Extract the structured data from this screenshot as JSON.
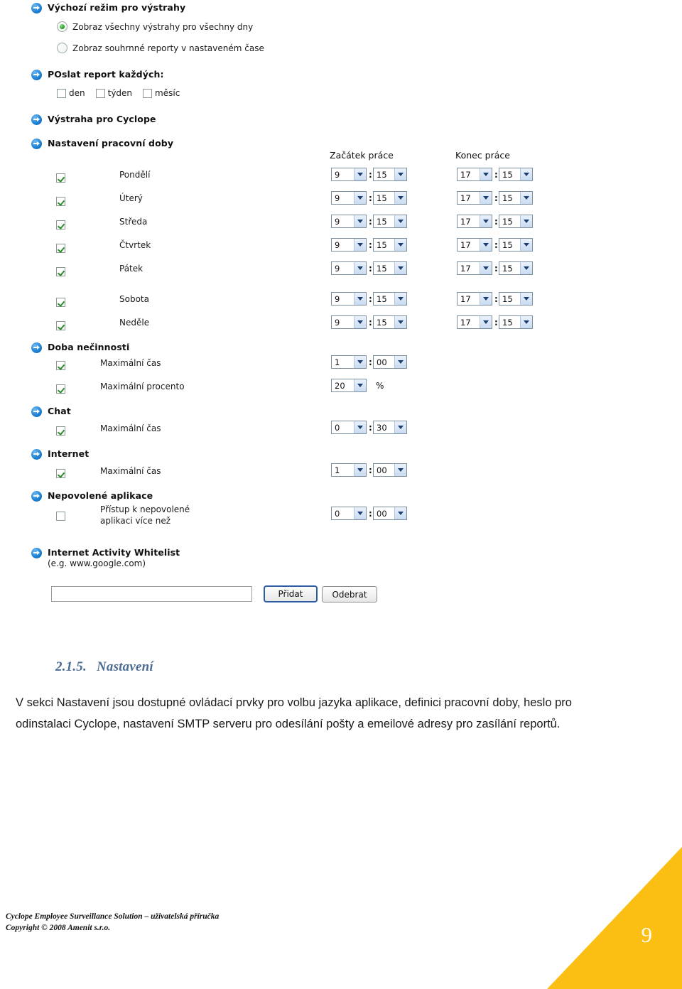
{
  "app": {
    "sections": {
      "alert_mode": {
        "title": "Výchozí režim pro výstrahy",
        "options": [
          {
            "label": "Zobraz všechny výstrahy pro všechny dny",
            "selected": true
          },
          {
            "label": "Zobraz souhrnné reporty v nastaveném čase",
            "selected": false
          }
        ]
      },
      "report_interval": {
        "title": "POslat report každých:",
        "checkboxes": [
          {
            "label": "den",
            "checked": false
          },
          {
            "label": "týden",
            "checked": false
          },
          {
            "label": "měsíc",
            "checked": false
          }
        ]
      },
      "cyclope_alert": {
        "title": "Výstraha pro Cyclope"
      },
      "work_hours": {
        "title": "Nastavení pracovní doby",
        "col_start": "Začátek práce",
        "col_end": "Konec práce",
        "days": [
          {
            "label": "Pondělí",
            "checked": true,
            "start_h": "9",
            "start_m": "15",
            "end_h": "17",
            "end_m": "15"
          },
          {
            "label": "Úterý",
            "checked": true,
            "start_h": "9",
            "start_m": "15",
            "end_h": "17",
            "end_m": "15"
          },
          {
            "label": "Středa",
            "checked": true,
            "start_h": "9",
            "start_m": "15",
            "end_h": "17",
            "end_m": "15"
          },
          {
            "label": "Čtvrtek",
            "checked": true,
            "start_h": "9",
            "start_m": "15",
            "end_h": "17",
            "end_m": "15"
          },
          {
            "label": "Pátek",
            "checked": true,
            "start_h": "9",
            "start_m": "15",
            "end_h": "17",
            "end_m": "15"
          },
          {
            "label": "Sobota",
            "checked": true,
            "start_h": "9",
            "start_m": "15",
            "end_h": "17",
            "end_m": "15"
          },
          {
            "label": "Neděle",
            "checked": true,
            "start_h": "9",
            "start_m": "15",
            "end_h": "17",
            "end_m": "15"
          }
        ]
      },
      "idle_time": {
        "title": "Doba nečinnosti",
        "max_time": {
          "label": "Maximální čas",
          "checked": true,
          "hours": "1",
          "minutes": "00"
        },
        "max_percent": {
          "label": "Maximální procento",
          "checked": true,
          "value": "20",
          "unit": "%"
        }
      },
      "chat": {
        "title": "Chat",
        "max_time": {
          "label": "Maximální čas",
          "checked": true,
          "hours": "0",
          "minutes": "30"
        }
      },
      "internet": {
        "title": "Internet",
        "max_time": {
          "label": "Maximální čas",
          "checked": true,
          "hours": "1",
          "minutes": "00"
        }
      },
      "disallowed_apps": {
        "title": "Nepovolené aplikace",
        "rule": {
          "label": "Přístup k nepovolené\naplikaci více než",
          "checked": false,
          "hours": "0",
          "minutes": "00"
        }
      },
      "whitelist": {
        "title": "Internet Activity Whitelist",
        "subtitle": "(e.g. www.google.com)",
        "input_value": "",
        "add_button": "Přidat",
        "remove_button": "Odebrat"
      }
    },
    "separator": ":"
  },
  "document": {
    "heading_number": "2.1.5.",
    "heading_title": "Nastavení",
    "paragraph": "V sekci Nastavení jsou dostupné ovládací prvky pro volbu jazyka aplikace, definici pracovní doby, heslo pro odinstalaci Cyclope, nastavení SMTP serveru pro odesílání pošty a emeilové adresy pro zasílání reportů.",
    "footer_line1": "Cyclope Employee Surveillance Solution – uživatelská příručka",
    "footer_line2": "Copyright © 2008 Amenit s.r.o.",
    "page_number": "9"
  }
}
